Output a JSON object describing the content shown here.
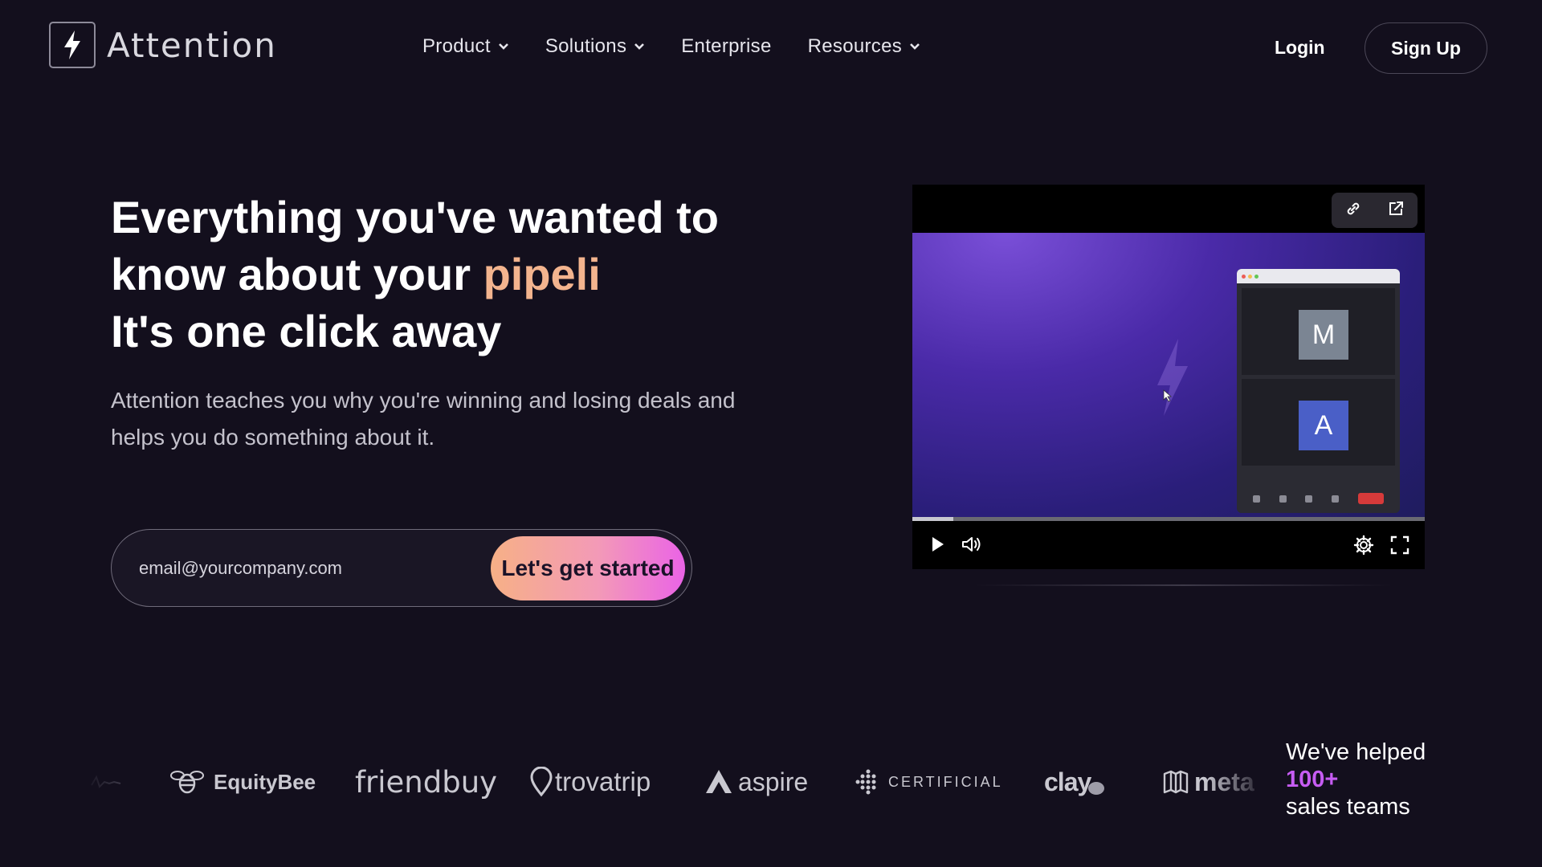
{
  "nav": {
    "brand": "Attention",
    "menu": [
      {
        "label": "Product",
        "dropdown": true
      },
      {
        "label": "Solutions",
        "dropdown": true
      },
      {
        "label": "Enterprise",
        "dropdown": false
      },
      {
        "label": "Resources",
        "dropdown": true
      }
    ],
    "login": "Login",
    "signup": "Sign Up"
  },
  "hero": {
    "line1": "Everything you've wanted to",
    "line2_prefix": "know about your ",
    "line2_accent": "pipeli",
    "line3": "It's one click away",
    "subtitle": "Attention teaches you why you're winning and losing deals and helps you do something about it.",
    "email_placeholder": "email@yourcompany.com",
    "cta": "Let's get started",
    "accent_color": "#f3b48e"
  },
  "video": {
    "top_icons": [
      "link-icon",
      "external-link-icon"
    ],
    "meeting_avatars": [
      "M",
      "A"
    ],
    "progress": 0.08,
    "controls": [
      "play-icon",
      "volume-icon",
      "settings-icon",
      "fullscreen-icon"
    ]
  },
  "logos": {
    "items": [
      "EquityBee",
      "friendbuy",
      "trovatrip",
      "aspire",
      "CERTIFICIAL",
      "clay",
      "meta"
    ]
  },
  "social_proof": {
    "line1": "We've helped",
    "count": "100+",
    "line3": "sales teams"
  }
}
